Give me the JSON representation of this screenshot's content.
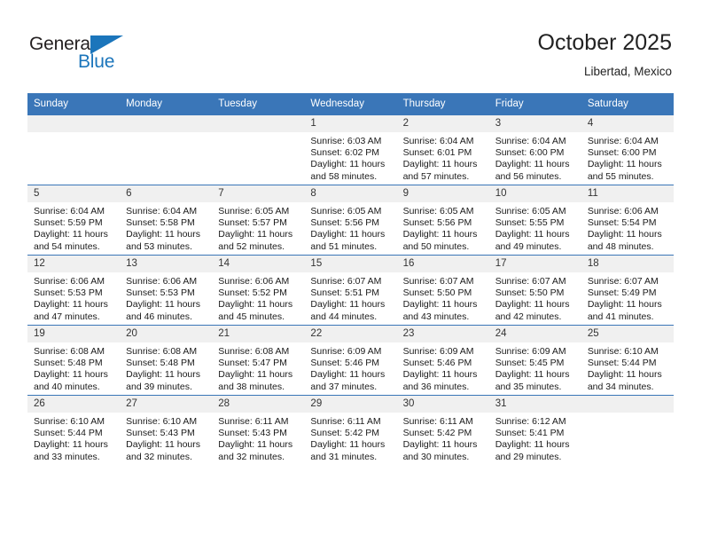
{
  "brand": {
    "name_top": "General",
    "name_bottom": "Blue",
    "accent_color": "#1b75bb"
  },
  "header": {
    "title": "October 2025",
    "subtitle": "Libertad, Mexico",
    "header_bg": "#3a76b8",
    "header_text_color": "#ffffff"
  },
  "weekday_headers": [
    "Sunday",
    "Monday",
    "Tuesday",
    "Wednesday",
    "Thursday",
    "Friday",
    "Saturday"
  ],
  "labels": {
    "sunrise_prefix": "Sunrise:",
    "sunset_prefix": "Sunset:",
    "daylight_prefix": "Daylight:"
  },
  "weeks": [
    [
      {
        "day": "",
        "sunrise": "",
        "sunset": "",
        "daylight_line1": "",
        "daylight_line2": ""
      },
      {
        "day": "",
        "sunrise": "",
        "sunset": "",
        "daylight_line1": "",
        "daylight_line2": ""
      },
      {
        "day": "",
        "sunrise": "",
        "sunset": "",
        "daylight_line1": "",
        "daylight_line2": ""
      },
      {
        "day": "1",
        "sunrise": "Sunrise: 6:03 AM",
        "sunset": "Sunset: 6:02 PM",
        "daylight_line1": "Daylight: 11 hours",
        "daylight_line2": "and 58 minutes."
      },
      {
        "day": "2",
        "sunrise": "Sunrise: 6:04 AM",
        "sunset": "Sunset: 6:01 PM",
        "daylight_line1": "Daylight: 11 hours",
        "daylight_line2": "and 57 minutes."
      },
      {
        "day": "3",
        "sunrise": "Sunrise: 6:04 AM",
        "sunset": "Sunset: 6:00 PM",
        "daylight_line1": "Daylight: 11 hours",
        "daylight_line2": "and 56 minutes."
      },
      {
        "day": "4",
        "sunrise": "Sunrise: 6:04 AM",
        "sunset": "Sunset: 6:00 PM",
        "daylight_line1": "Daylight: 11 hours",
        "daylight_line2": "and 55 minutes."
      }
    ],
    [
      {
        "day": "5",
        "sunrise": "Sunrise: 6:04 AM",
        "sunset": "Sunset: 5:59 PM",
        "daylight_line1": "Daylight: 11 hours",
        "daylight_line2": "and 54 minutes."
      },
      {
        "day": "6",
        "sunrise": "Sunrise: 6:04 AM",
        "sunset": "Sunset: 5:58 PM",
        "daylight_line1": "Daylight: 11 hours",
        "daylight_line2": "and 53 minutes."
      },
      {
        "day": "7",
        "sunrise": "Sunrise: 6:05 AM",
        "sunset": "Sunset: 5:57 PM",
        "daylight_line1": "Daylight: 11 hours",
        "daylight_line2": "and 52 minutes."
      },
      {
        "day": "8",
        "sunrise": "Sunrise: 6:05 AM",
        "sunset": "Sunset: 5:56 PM",
        "daylight_line1": "Daylight: 11 hours",
        "daylight_line2": "and 51 minutes."
      },
      {
        "day": "9",
        "sunrise": "Sunrise: 6:05 AM",
        "sunset": "Sunset: 5:56 PM",
        "daylight_line1": "Daylight: 11 hours",
        "daylight_line2": "and 50 minutes."
      },
      {
        "day": "10",
        "sunrise": "Sunrise: 6:05 AM",
        "sunset": "Sunset: 5:55 PM",
        "daylight_line1": "Daylight: 11 hours",
        "daylight_line2": "and 49 minutes."
      },
      {
        "day": "11",
        "sunrise": "Sunrise: 6:06 AM",
        "sunset": "Sunset: 5:54 PM",
        "daylight_line1": "Daylight: 11 hours",
        "daylight_line2": "and 48 minutes."
      }
    ],
    [
      {
        "day": "12",
        "sunrise": "Sunrise: 6:06 AM",
        "sunset": "Sunset: 5:53 PM",
        "daylight_line1": "Daylight: 11 hours",
        "daylight_line2": "and 47 minutes."
      },
      {
        "day": "13",
        "sunrise": "Sunrise: 6:06 AM",
        "sunset": "Sunset: 5:53 PM",
        "daylight_line1": "Daylight: 11 hours",
        "daylight_line2": "and 46 minutes."
      },
      {
        "day": "14",
        "sunrise": "Sunrise: 6:06 AM",
        "sunset": "Sunset: 5:52 PM",
        "daylight_line1": "Daylight: 11 hours",
        "daylight_line2": "and 45 minutes."
      },
      {
        "day": "15",
        "sunrise": "Sunrise: 6:07 AM",
        "sunset": "Sunset: 5:51 PM",
        "daylight_line1": "Daylight: 11 hours",
        "daylight_line2": "and 44 minutes."
      },
      {
        "day": "16",
        "sunrise": "Sunrise: 6:07 AM",
        "sunset": "Sunset: 5:50 PM",
        "daylight_line1": "Daylight: 11 hours",
        "daylight_line2": "and 43 minutes."
      },
      {
        "day": "17",
        "sunrise": "Sunrise: 6:07 AM",
        "sunset": "Sunset: 5:50 PM",
        "daylight_line1": "Daylight: 11 hours",
        "daylight_line2": "and 42 minutes."
      },
      {
        "day": "18",
        "sunrise": "Sunrise: 6:07 AM",
        "sunset": "Sunset: 5:49 PM",
        "daylight_line1": "Daylight: 11 hours",
        "daylight_line2": "and 41 minutes."
      }
    ],
    [
      {
        "day": "19",
        "sunrise": "Sunrise: 6:08 AM",
        "sunset": "Sunset: 5:48 PM",
        "daylight_line1": "Daylight: 11 hours",
        "daylight_line2": "and 40 minutes."
      },
      {
        "day": "20",
        "sunrise": "Sunrise: 6:08 AM",
        "sunset": "Sunset: 5:48 PM",
        "daylight_line1": "Daylight: 11 hours",
        "daylight_line2": "and 39 minutes."
      },
      {
        "day": "21",
        "sunrise": "Sunrise: 6:08 AM",
        "sunset": "Sunset: 5:47 PM",
        "daylight_line1": "Daylight: 11 hours",
        "daylight_line2": "and 38 minutes."
      },
      {
        "day": "22",
        "sunrise": "Sunrise: 6:09 AM",
        "sunset": "Sunset: 5:46 PM",
        "daylight_line1": "Daylight: 11 hours",
        "daylight_line2": "and 37 minutes."
      },
      {
        "day": "23",
        "sunrise": "Sunrise: 6:09 AM",
        "sunset": "Sunset: 5:46 PM",
        "daylight_line1": "Daylight: 11 hours",
        "daylight_line2": "and 36 minutes."
      },
      {
        "day": "24",
        "sunrise": "Sunrise: 6:09 AM",
        "sunset": "Sunset: 5:45 PM",
        "daylight_line1": "Daylight: 11 hours",
        "daylight_line2": "and 35 minutes."
      },
      {
        "day": "25",
        "sunrise": "Sunrise: 6:10 AM",
        "sunset": "Sunset: 5:44 PM",
        "daylight_line1": "Daylight: 11 hours",
        "daylight_line2": "and 34 minutes."
      }
    ],
    [
      {
        "day": "26",
        "sunrise": "Sunrise: 6:10 AM",
        "sunset": "Sunset: 5:44 PM",
        "daylight_line1": "Daylight: 11 hours",
        "daylight_line2": "and 33 minutes."
      },
      {
        "day": "27",
        "sunrise": "Sunrise: 6:10 AM",
        "sunset": "Sunset: 5:43 PM",
        "daylight_line1": "Daylight: 11 hours",
        "daylight_line2": "and 32 minutes."
      },
      {
        "day": "28",
        "sunrise": "Sunrise: 6:11 AM",
        "sunset": "Sunset: 5:43 PM",
        "daylight_line1": "Daylight: 11 hours",
        "daylight_line2": "and 32 minutes."
      },
      {
        "day": "29",
        "sunrise": "Sunrise: 6:11 AM",
        "sunset": "Sunset: 5:42 PM",
        "daylight_line1": "Daylight: 11 hours",
        "daylight_line2": "and 31 minutes."
      },
      {
        "day": "30",
        "sunrise": "Sunrise: 6:11 AM",
        "sunset": "Sunset: 5:42 PM",
        "daylight_line1": "Daylight: 11 hours",
        "daylight_line2": "and 30 minutes."
      },
      {
        "day": "31",
        "sunrise": "Sunrise: 6:12 AM",
        "sunset": "Sunset: 5:41 PM",
        "daylight_line1": "Daylight: 11 hours",
        "daylight_line2": "and 29 minutes."
      },
      {
        "day": "",
        "sunrise": "",
        "sunset": "",
        "daylight_line1": "",
        "daylight_line2": ""
      }
    ]
  ]
}
